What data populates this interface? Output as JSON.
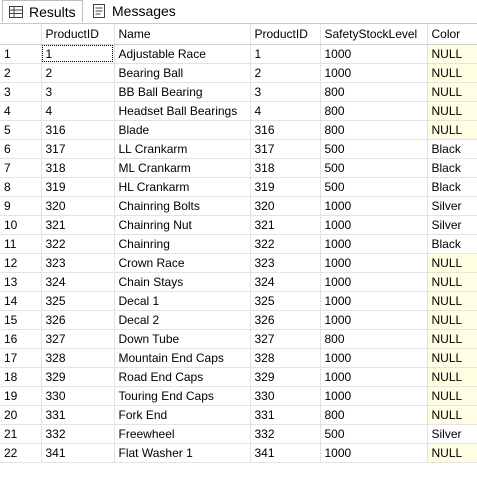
{
  "tabs": [
    {
      "label": "Results",
      "icon": "grid-icon"
    },
    {
      "label": "Messages",
      "icon": "messages-icon"
    }
  ],
  "columns": [
    "",
    "ProductID",
    "Name",
    "ProductID",
    "SafetyStockLevel",
    "Color"
  ],
  "rows": [
    [
      "1",
      "1",
      "Adjustable Race",
      "1",
      "1000",
      "NULL"
    ],
    [
      "2",
      "2",
      "Bearing Ball",
      "2",
      "1000",
      "NULL"
    ],
    [
      "3",
      "3",
      "BB Ball Bearing",
      "3",
      "800",
      "NULL"
    ],
    [
      "4",
      "4",
      "Headset Ball Bearings",
      "4",
      "800",
      "NULL"
    ],
    [
      "5",
      "316",
      "Blade",
      "316",
      "800",
      "NULL"
    ],
    [
      "6",
      "317",
      "LL Crankarm",
      "317",
      "500",
      "Black"
    ],
    [
      "7",
      "318",
      "ML Crankarm",
      "318",
      "500",
      "Black"
    ],
    [
      "8",
      "319",
      "HL Crankarm",
      "319",
      "500",
      "Black"
    ],
    [
      "9",
      "320",
      "Chainring Bolts",
      "320",
      "1000",
      "Silver"
    ],
    [
      "10",
      "321",
      "Chainring Nut",
      "321",
      "1000",
      "Silver"
    ],
    [
      "11",
      "322",
      "Chainring",
      "322",
      "1000",
      "Black"
    ],
    [
      "12",
      "323",
      "Crown Race",
      "323",
      "1000",
      "NULL"
    ],
    [
      "13",
      "324",
      "Chain Stays",
      "324",
      "1000",
      "NULL"
    ],
    [
      "14",
      "325",
      "Decal 1",
      "325",
      "1000",
      "NULL"
    ],
    [
      "15",
      "326",
      "Decal 2",
      "326",
      "1000",
      "NULL"
    ],
    [
      "16",
      "327",
      "Down Tube",
      "327",
      "800",
      "NULL"
    ],
    [
      "17",
      "328",
      "Mountain End Caps",
      "328",
      "1000",
      "NULL"
    ],
    [
      "18",
      "329",
      "Road End Caps",
      "329",
      "1000",
      "NULL"
    ],
    [
      "19",
      "330",
      "Touring End Caps",
      "330",
      "1000",
      "NULL"
    ],
    [
      "20",
      "331",
      "Fork End",
      "331",
      "800",
      "NULL"
    ],
    [
      "21",
      "332",
      "Freewheel",
      "332",
      "500",
      "Silver"
    ],
    [
      "22",
      "341",
      "Flat Washer 1",
      "341",
      "1000",
      "NULL"
    ]
  ],
  "colors": {
    "null_cell_bg": "#fffde2",
    "grid_line": "#e3e3e3"
  }
}
